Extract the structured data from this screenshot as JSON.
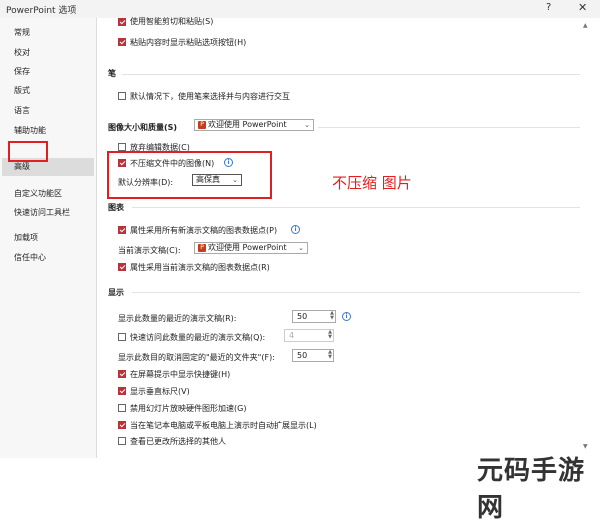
{
  "window": {
    "title": "PowerPoint 选项",
    "help": "?",
    "close": "✕"
  },
  "sidebar": {
    "items": [
      {
        "label": "常规"
      },
      {
        "label": "校对"
      },
      {
        "label": "保存"
      },
      {
        "label": "版式"
      },
      {
        "label": "语言"
      },
      {
        "label": "辅助功能"
      },
      {
        "label": "高级"
      },
      {
        "label": "自定义功能区"
      },
      {
        "label": "快速访问工具栏"
      },
      {
        "label": "加载项"
      },
      {
        "label": "信任中心"
      }
    ],
    "selected": "高级"
  },
  "top": {
    "partial_item": "使用智能剪切和粘贴(S)",
    "paste_button": "粘贴内容时显示粘贴选项按钮(H)"
  },
  "pen": {
    "heading": "笔",
    "default_interact": "默认情况下，使用笔来选择并与内容进行交互"
  },
  "image": {
    "heading": "图像大小和质量(S)",
    "scope": "欢迎使用 PowerPoint",
    "discard_edit": "放弃编辑数据(C)",
    "no_compress": "不压缩文件中的图像(N)",
    "resolution_label": "默认分辨率(D):",
    "resolution_value": "高保真"
  },
  "annotation": "不压缩  图片",
  "chart": {
    "heading": "图表",
    "all_new": "属性采用所有新演示文稿的图表数据点(P)",
    "current_label": "当前演示文稿(C):",
    "current_value": "欢迎使用 PowerPoint",
    "current_points": "属性采用当前演示文稿的图表数据点(R)"
  },
  "display": {
    "heading": "显示",
    "recent_count_label": "显示此数量的最近的演示文稿(R):",
    "recent_count": "50",
    "quick_access": "快速访问此数量的最近的演示文稿(Q):",
    "quick_access_count": "4",
    "unpinned_label": "显示此数目的取消固定的\"最近的文件夹\"(F):",
    "unpinned_count": "50",
    "shortcut_keys": "在屏幕提示中显示快捷键(H)",
    "vertical_ruler": "显示垂直标尺(V)",
    "disable_hw": "禁用幻灯片放映硬件图形加速(G)",
    "auto_expand": "当在笔记本电脑或平板电脑上演示时自动扩展显示(L)",
    "partial_last": "查看已更改所选择的其他人"
  },
  "watermark": "元码手游网"
}
